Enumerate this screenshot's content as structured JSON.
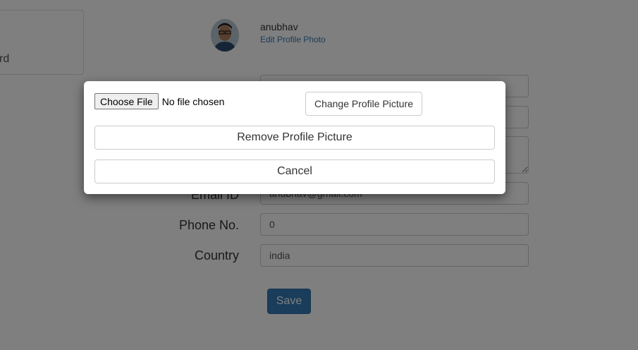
{
  "sidebar": {
    "item_label": "rd"
  },
  "profile": {
    "username": "anubhav",
    "edit_photo_label": "Edit Profile Photo"
  },
  "form": {
    "email_label": "Email ID",
    "email_value": "anubhav@gmail.com",
    "phone_label": "Phone No.",
    "phone_value": "0",
    "country_label": "Country",
    "country_value": "india",
    "save_label": "Save"
  },
  "modal": {
    "choose_file_label": "Choose File",
    "file_status": "No file chosen",
    "change_picture_label": "Change Profile Picture",
    "remove_picture_label": "Remove Profile Picture",
    "cancel_label": "Cancel"
  }
}
